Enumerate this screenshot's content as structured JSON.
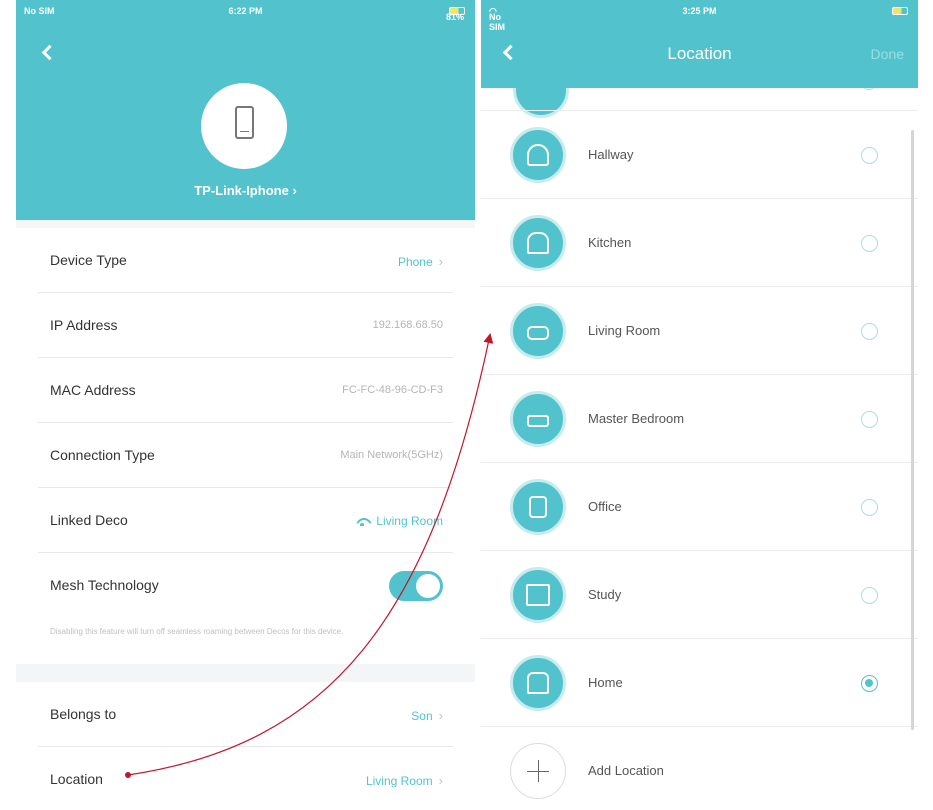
{
  "left_screen": {
    "status_bar": {
      "carrier": "No SIM",
      "time": "6:22 PM",
      "battery": "81%"
    },
    "device_name": "TP-Link-Iphone",
    "device_name_chevron": "›",
    "rows": [
      {
        "label": "Device Type",
        "value": "Phone",
        "chevron": "›"
      },
      {
        "label": "IP Address",
        "value": "192.168.68.50"
      },
      {
        "label": "MAC Address",
        "value": "FC-FC-48-96-CD-F3"
      },
      {
        "label": "Connection Type",
        "value": "Main Network(5GHz)"
      },
      {
        "label": "Linked Deco",
        "value": "Living Room"
      },
      {
        "label": "Mesh Technology",
        "toggle_on": true
      }
    ],
    "mesh_note": "Disabling this feature will turn off seamless roaming between Decos for this device.",
    "rows2": [
      {
        "label": "Belongs to",
        "value": "Son",
        "chevron": "›"
      },
      {
        "label": "Location",
        "value": "Living Room",
        "chevron": "›"
      }
    ]
  },
  "right_screen": {
    "status_bar": {
      "carrier": "No SIM",
      "time": "3:25 PM",
      "battery": ""
    },
    "title": "Location",
    "done_label": "Done",
    "locations": [
      {
        "label": "Hallway",
        "selected": false
      },
      {
        "label": "Kitchen",
        "selected": false
      },
      {
        "label": "Living Room",
        "selected": false
      },
      {
        "label": "Master Bedroom",
        "selected": false
      },
      {
        "label": "Office",
        "selected": false
      },
      {
        "label": "Study",
        "selected": false
      },
      {
        "label": "Home",
        "selected": true
      }
    ],
    "add_location_label": "Add Location"
  },
  "colors": {
    "accent": "#52c3cd",
    "annotation_arrow": "#c0172b"
  }
}
